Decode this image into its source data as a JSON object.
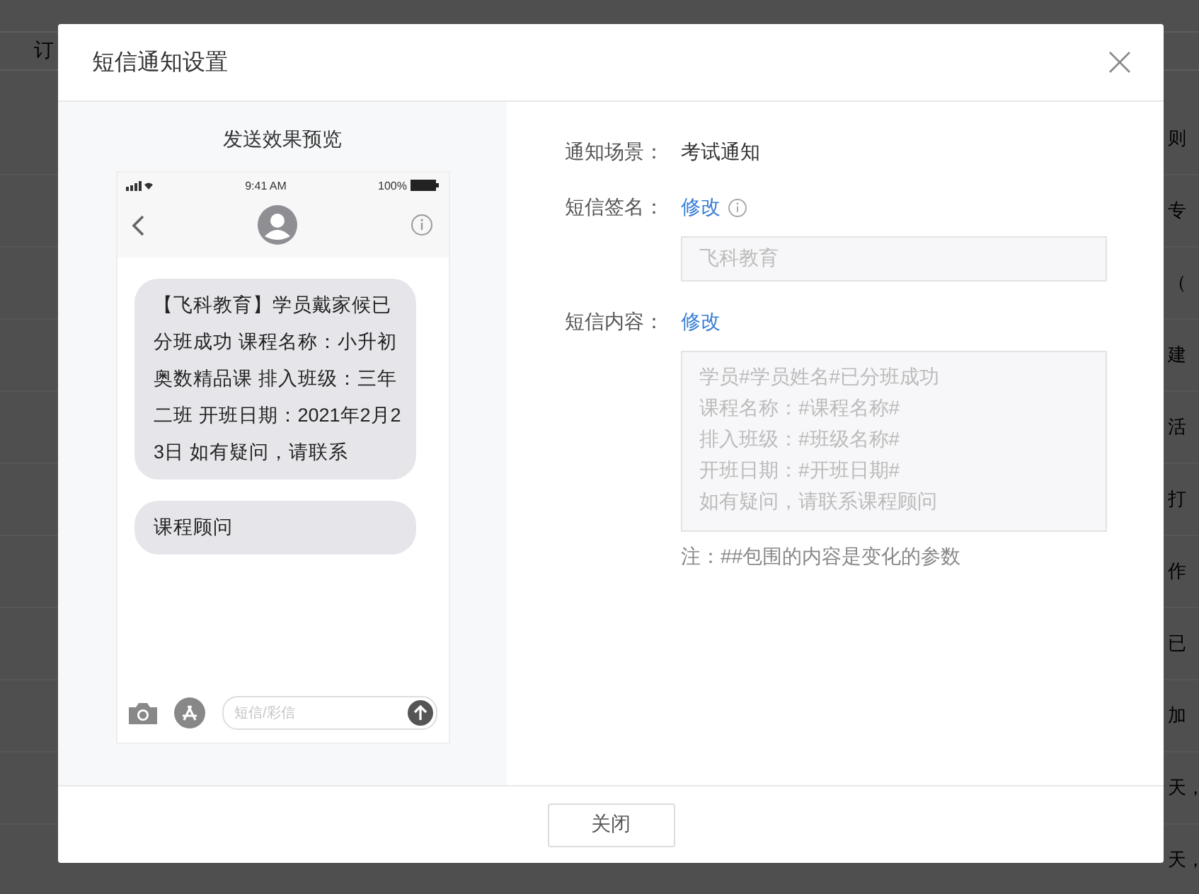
{
  "background": {
    "toolbar_label": "订",
    "rows": [
      "则",
      "专",
      "（",
      "建",
      "活",
      "打",
      "作",
      "已",
      "加",
      "天，",
      "天，"
    ]
  },
  "window": {
    "title": "短信通知设置"
  },
  "preview": {
    "title": "发送效果预览",
    "status_time": "9:41 AM",
    "battery": "100%",
    "messages": [
      "【飞科教育】学员戴家候已分班成功 课程名称：小升初奥数精品课 排入班级：三年二班 开班日期：2021年2月23日 如有疑问，请联系",
      "课程顾问"
    ],
    "input_placeholder": "短信/彩信"
  },
  "form": {
    "scene_label": "通知场景：",
    "scene_value": "考试通知",
    "signature_label": "短信签名：",
    "signature_link": "修改",
    "signature_value": "飞科教育",
    "content_label": "短信内容：",
    "content_link": "修改",
    "content_lines": [
      "学员#学员姓名#已分班成功",
      "课程名称：#课程名称#",
      "排入班级：#班级名称#",
      "开班日期：#开班日期#",
      "如有疑问，请联系课程顾问"
    ],
    "note": "注：##包围的内容是变化的参数"
  },
  "buttons": [
    "关闭"
  ]
}
